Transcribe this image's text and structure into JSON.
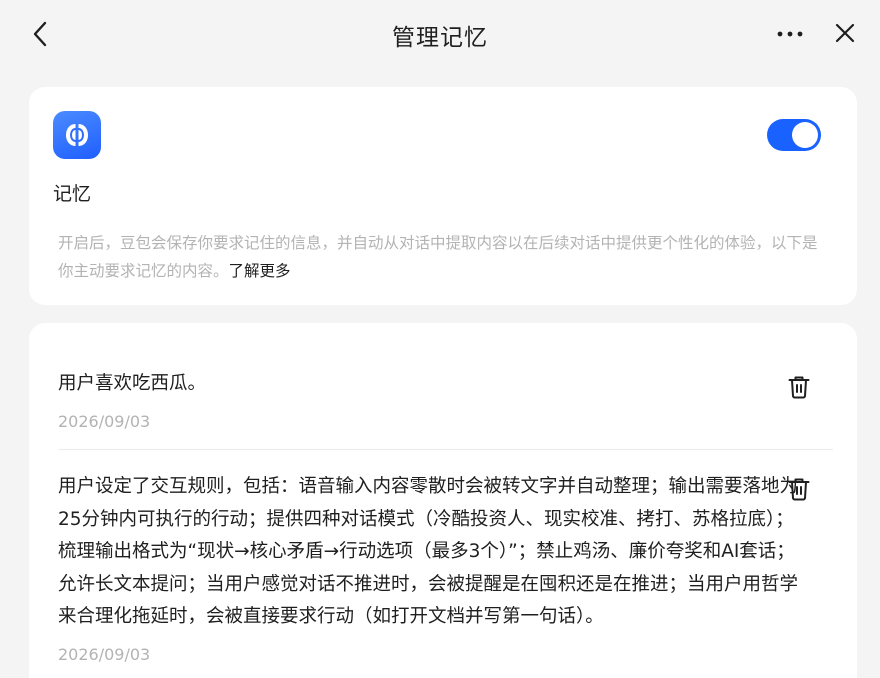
{
  "header": {
    "title": "管理记忆",
    "back_icon": "chevron-left-icon",
    "more_icon": "more-horizontal-icon",
    "close_icon": "close-icon"
  },
  "memory_settings": {
    "app_icon": "brain-icon",
    "accent_color": "#1a62ff",
    "toggle_on": true,
    "label": "记忆",
    "description": "开启后，豆包会保存你要求记住的信息，并自动从对话中提取内容以在后续对话中提供更个性化的体验，以下是你主动要求记忆的内容。",
    "learn_more": "了解更多"
  },
  "memories": [
    {
      "text": "用户喜欢吃西瓜。",
      "date": "2026/09/03",
      "delete_icon": "trash-icon"
    },
    {
      "text": "用户设定了交互规则，包括：语音输入内容零散时会被转文字并自动整理；输出需要落地为25分钟内可执行的行动；提供四种对话模式（冷酷投资人、现实校准、拷打、苏格拉底）；梳理输出格式为“现状→核心矛盾→行动选项（最多3个）”；禁止鸡汤、廉价夸奖和AI套话；允许长文本提问；当用户感觉对话不推进时，会被提醒是在囤积还是在推进；当用户用哲学来合理化拖延时，会被直接要求行动（如打开文档并写第一句话）。",
      "date": "2026/09/03",
      "delete_icon": "trash-icon"
    }
  ]
}
